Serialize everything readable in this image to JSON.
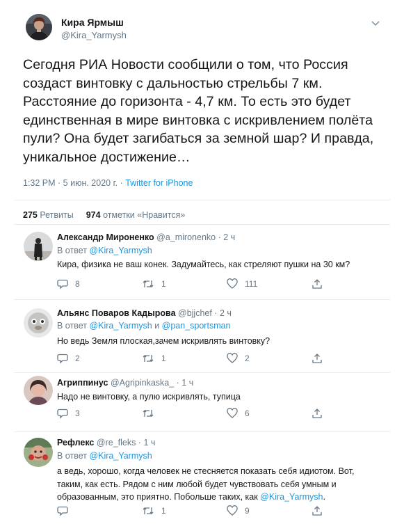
{
  "tweet": {
    "name": "Кира Ярмыш",
    "handle": "@Kira_Yarmysh",
    "text": "Сегодня РИА Новости сообщили о том, что Россия создаст винтовку с дальностью стрельбы 7 км. Расстояние до горизонта - 4,7 км. То есть это будет единственная в мире винтовка с искривлением полёта пули? Она будет загибаться за земной шар? И правда, уникальное достижение…",
    "time": "1:32 PM · 5 июн. 2020 г.",
    "dot": " · ",
    "via": "Twitter for iPhone",
    "retweets_count": "275",
    "retweets_label": "Ретвиты",
    "likes_count": "974",
    "likes_label": "отметки «Нравится»"
  },
  "replies": [
    {
      "name": "Александр Мироненко",
      "handle": "@a_mironenko · 2 ч",
      "in_reply_prefix": "В ответ ",
      "in_reply_mention1": "@Kira_Yarmysh",
      "in_reply_and": "",
      "in_reply_mention2": "",
      "text": "Кира, физика не ваш конек. Задумайтесь, как стреляют пушки на 30 км?",
      "replies": "8",
      "retweets": "1",
      "likes": "111"
    },
    {
      "name": "Альянс Поваров Кадырова",
      "handle": "@bjjchef · 2 ч",
      "in_reply_prefix": "В ответ ",
      "in_reply_mention1": "@Kira_Yarmysh",
      "in_reply_and": " и ",
      "in_reply_mention2": "@pan_sportsman",
      "text": "Но ведь Земля плоская,зачем искривлять винтовку?",
      "replies": "2",
      "retweets": "1",
      "likes": "2"
    },
    {
      "name": "Агриппинус",
      "handle": "@Agripinkaska_ · 1 ч",
      "text": "Надо не винтовку, а пулю искривлять, тупица",
      "replies": "3",
      "retweets": "",
      "likes": "6"
    },
    {
      "name": "Рефлекс",
      "handle": "@re_fleks · 1 ч",
      "in_reply_prefix": "В ответ ",
      "in_reply_mention1": "@Kira_Yarmysh",
      "text_before": "а ведь, хорошо, когда человек не стесняется показать себя идиотом. Вот, таким, как есть. Рядом с ним любой будет чувствовать себя умным и образованным, это приятно. Побольше таких, как ",
      "text_mention": "@Kira_Yarmysh",
      "text_after": ".",
      "replies": "",
      "retweets": "1",
      "likes": "9"
    }
  ],
  "icons": {
    "reply": "speech-bubble-icon",
    "retweet": "retweet-arrows-icon",
    "like": "heart-icon",
    "share": "share-upload-icon",
    "menu": "chevron-down-icon"
  },
  "colors": {
    "text": "#14171a",
    "secondary": "#657786",
    "link": "#1b95e0",
    "divider": "#e6ecf0"
  }
}
